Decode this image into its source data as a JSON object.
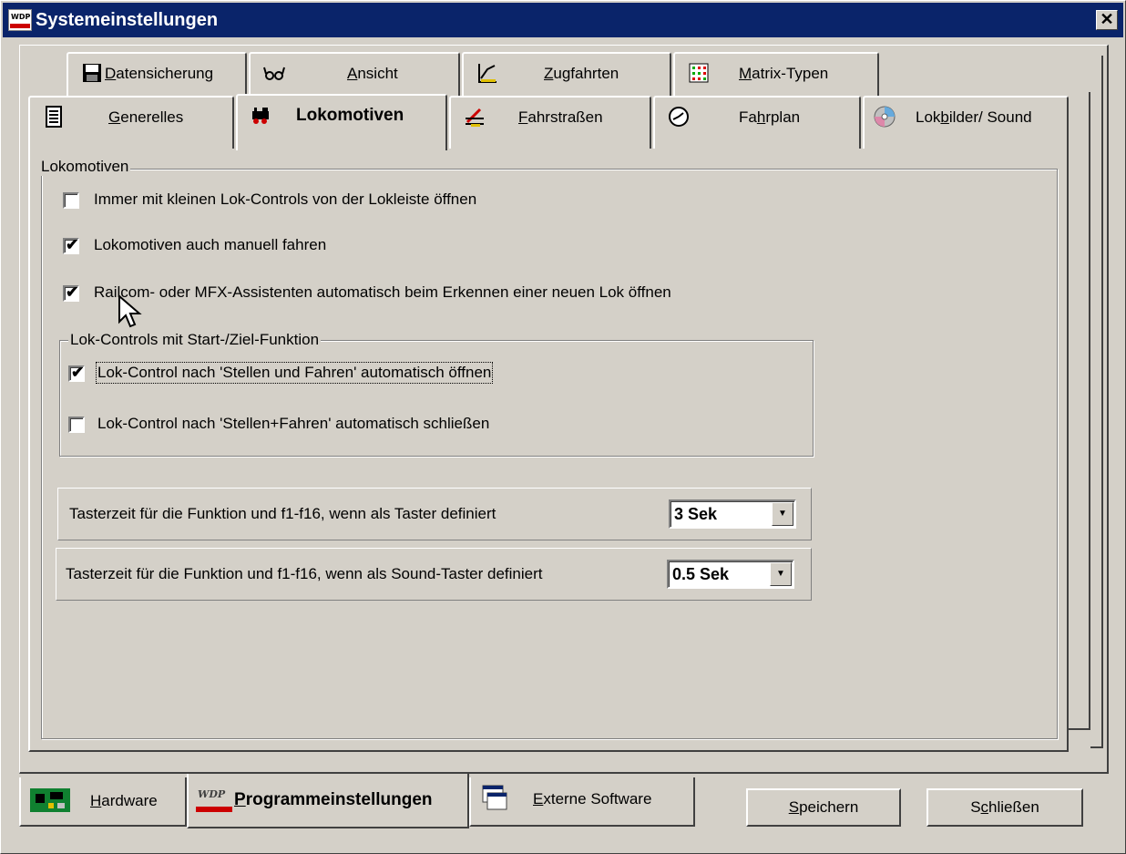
{
  "window": {
    "title": "Systemeinstellungen",
    "close_label": "✕"
  },
  "tabs_row1": [
    {
      "pre": "",
      "u": "D",
      "post": "atensicherung",
      "icon": "floppy-disk-icon"
    },
    {
      "pre": "",
      "u": "A",
      "post": "nsicht",
      "icon": "glasses-icon"
    },
    {
      "pre": "",
      "u": "Z",
      "post": "ugfahrten",
      "icon": "route-chart-icon"
    },
    {
      "pre": "",
      "u": "M",
      "post": "atrix-Typen",
      "icon": "matrix-grid-icon"
    }
  ],
  "tabs_row2": [
    {
      "pre": "",
      "u": "G",
      "post": "enerelles",
      "icon": "document-lines-icon"
    },
    {
      "pre": "",
      "u": "",
      "post": "Lokomotiven",
      "icon": "locomotive-icon",
      "active": true
    },
    {
      "pre": "",
      "u": "F",
      "post": "ahrstraßen",
      "icon": "track-signal-icon"
    },
    {
      "pre": "Fa",
      "u": "h",
      "post": "rplan",
      "icon": "clock-icon"
    },
    {
      "pre": "Lok",
      "u": "b",
      "post": "ilder/ Sound",
      "icon": "cd-disc-icon"
    }
  ],
  "lokomotiven": {
    "group_label": "Lokomotiven",
    "options": [
      {
        "label": "Immer mit kleinen Lok-Controls von der Lokleiste öffnen",
        "checked": false
      },
      {
        "label": "Lokomotiven auch manuell fahren",
        "checked": true
      },
      {
        "label": "Railcom- oder MFX-Assistenten automatisch beim Erkennen einer neuen Lok öffnen",
        "checked": true
      }
    ],
    "subgroup_label": "Lok-Controls mit Start-/Ziel-Funktion",
    "sub_options": [
      {
        "label": "Lok-Control nach 'Stellen und Fahren' automatisch öffnen",
        "checked": true
      },
      {
        "label": "Lok-Control nach 'Stellen+Fahren' automatisch schließen",
        "checked": false
      }
    ],
    "taster_label": "Tasterzeit für die Funktion und f1-f16, wenn als Taster definiert",
    "taster_value": "3 Sek",
    "sound_taster_label": "Tasterzeit für die Funktion und f1-f16, wenn als Sound-Taster definiert",
    "sound_taster_value": "0.5 Sek"
  },
  "bottom_tabs": [
    {
      "pre": "",
      "u": "H",
      "post": "ardware",
      "icon": "circuit-board-icon"
    },
    {
      "pre": "",
      "u": "P",
      "post": "rogrammeinstellungen",
      "icon": "wdp-logo-icon",
      "active": true
    },
    {
      "pre": "",
      "u": "E",
      "post": "xterne Software",
      "icon": "application-window-icon"
    }
  ],
  "buttons": {
    "save": {
      "pre": "",
      "u": "S",
      "post": "peichern"
    },
    "close": {
      "pre": "S",
      "u": "c",
      "post": "hließen"
    }
  },
  "checkmark": "✔"
}
